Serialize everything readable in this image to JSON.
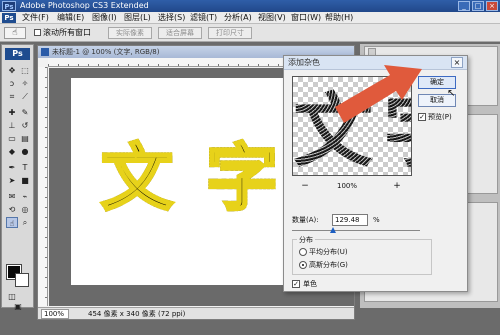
{
  "app": {
    "title": "Adobe Photoshop CS3 Extended",
    "logo": "Ps",
    "window_buttons": [
      "_",
      "□",
      "×"
    ]
  },
  "menu": [
    "文件(F)",
    "编辑(E)",
    "图像(I)",
    "图层(L)",
    "选择(S)",
    "滤镜(T)",
    "分析(A)",
    "视图(V)",
    "窗口(W)",
    "帮助(H)"
  ],
  "options": {
    "tool_icon": "hand-icon",
    "tool_glyph": "☝",
    "checkbox_label": "滚动所有窗口",
    "buttons": [
      "实际像素",
      "适合屏幕",
      "打印尺寸"
    ]
  },
  "document": {
    "title": "未标题-1 @ 100% (文字, RGB/8)",
    "text_chars": [
      "文",
      "字"
    ],
    "zoom": "100%",
    "status_info": "454 像素 x 340 像素 (72 ppi)"
  },
  "dialog": {
    "title": "添加杂色",
    "ok_label": "确定",
    "cancel_label": "取消",
    "preview_label": "预览(P)",
    "preview_checked": true,
    "preview_zoom": "100%",
    "amount_label": "数量(A):",
    "amount_value": "129.48",
    "amount_unit": "%",
    "amount_slider_fraction": 0.32,
    "distribution_label": "分布",
    "uniform_label": "平均分布(U)",
    "gaussian_label": "高斯分布(G)",
    "distribution_selected": "gaussian",
    "mono_label": "单色",
    "mono_checked": true,
    "preview_chars": [
      "文",
      "字"
    ]
  },
  "colors": {
    "accent_arrow": "#e05a3c",
    "text_stroke": "#e7d21a",
    "selection_blue": "#1d5fc2"
  }
}
